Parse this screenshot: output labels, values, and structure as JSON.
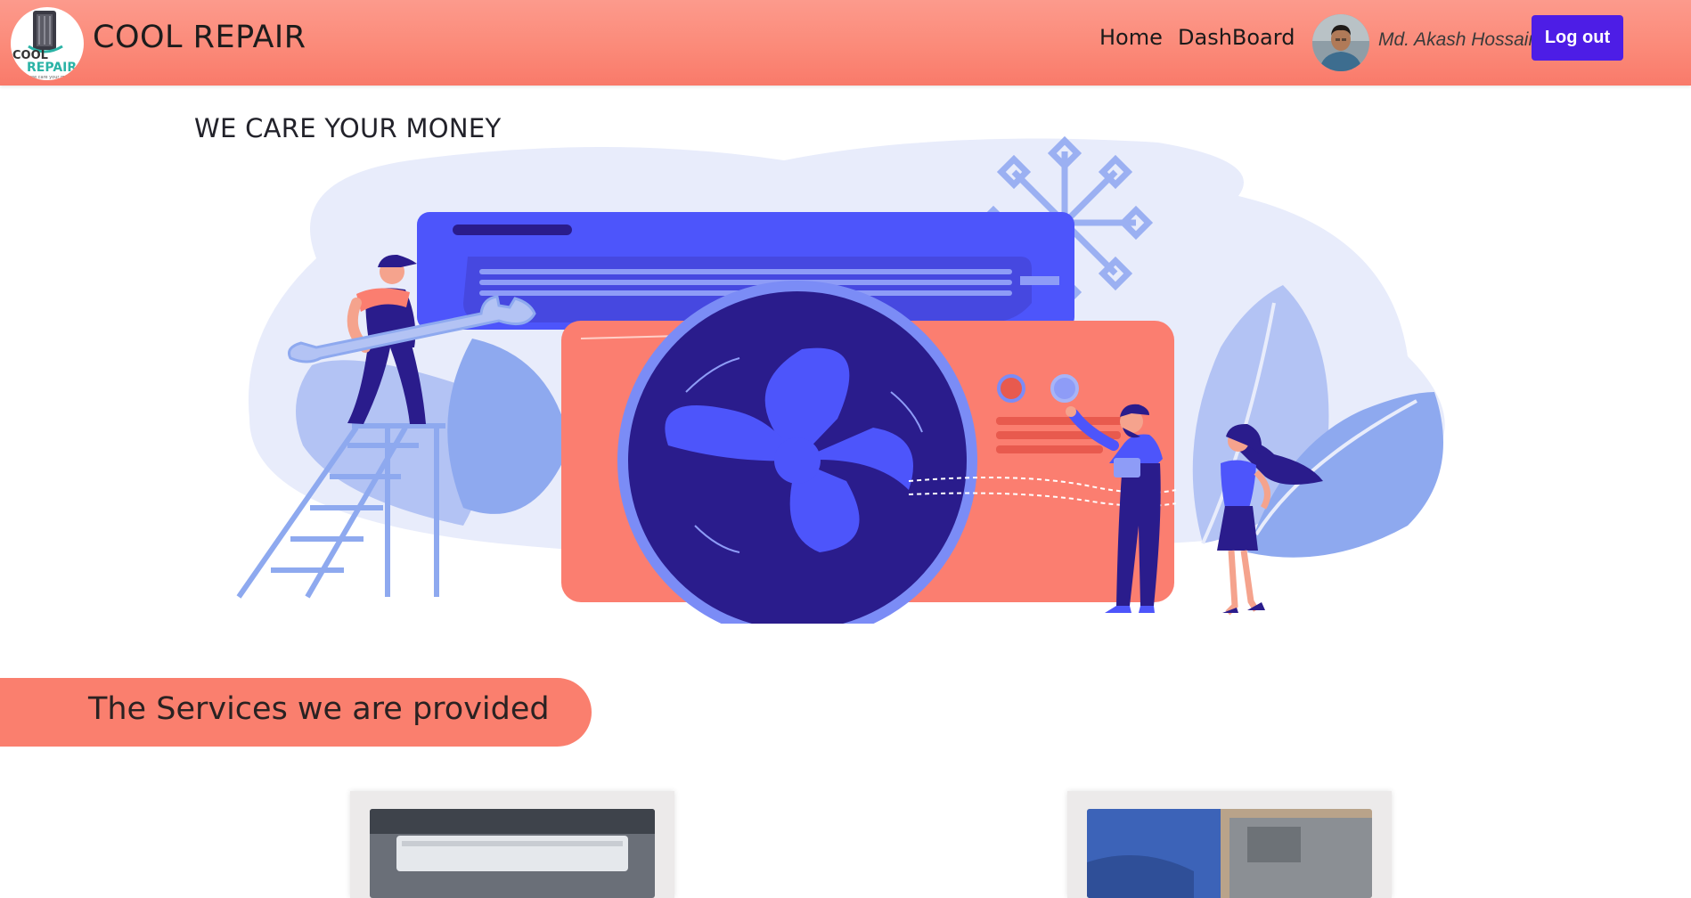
{
  "navbar": {
    "brand": "COOL REPAIR",
    "logo_text_top": "COOL",
    "logo_text_bottom": "REPAIR",
    "logo_tagline": "we care your money",
    "links": [
      {
        "label": "Home"
      },
      {
        "label": "DashBoard"
      }
    ],
    "user_name": "Md. Akash Hossain",
    "logout_label": "Log out"
  },
  "hero": {
    "heading": "WE CARE YOUR MONEY"
  },
  "services": {
    "title": "The Services we are provided"
  },
  "colors": {
    "navbar": "#fb8a79",
    "accent": "#4d1de6",
    "banner": "#fa7f6e",
    "ac_blue": "#4d55fb",
    "ac_coral": "#fb7e70"
  }
}
